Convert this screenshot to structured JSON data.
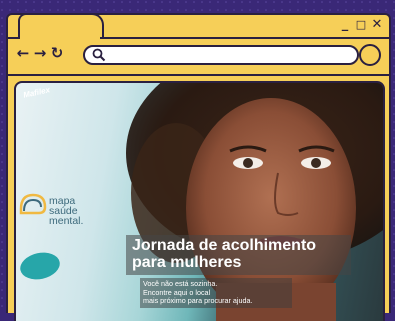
{
  "window": {
    "controls": {
      "minimize": "_",
      "maximize": "□",
      "close": "✕"
    }
  },
  "toolbar": {
    "back": "←",
    "forward": "→",
    "reload": "↻",
    "address_value": ""
  },
  "page": {
    "logo_text": [
      "mapa",
      "saúde",
      "mental."
    ],
    "badge_text": "Mafilex",
    "headline_line1": "Jornada de acolhimento",
    "headline_line2": "para mulheres",
    "sub_line1": "Você não está sozinha.",
    "sub_line2": "Encontre aqui o local",
    "sub_line3": "mais próximo para procurar ajuda."
  },
  "colors": {
    "background": "#3a2877",
    "browser_chrome": "#f6cf58",
    "outline": "#2a2040",
    "logo_teal": "#27a6a9"
  }
}
